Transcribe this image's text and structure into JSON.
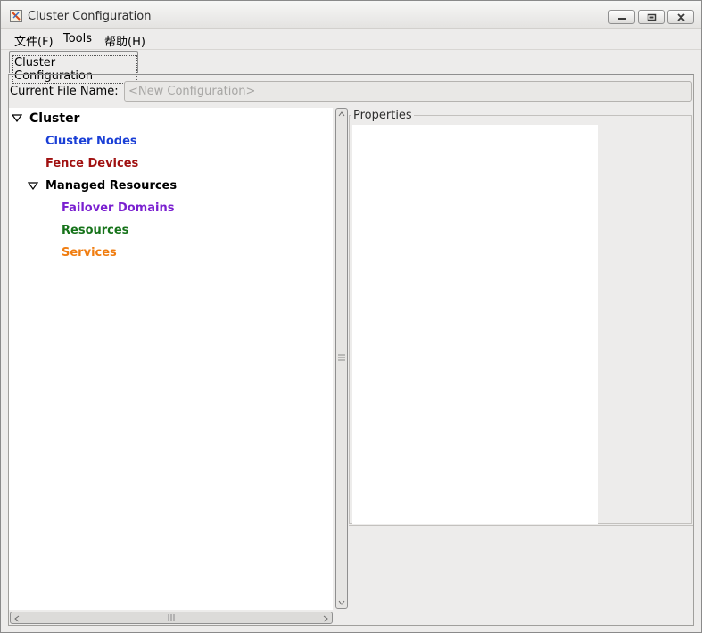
{
  "window": {
    "title": "Cluster Configuration"
  },
  "menu": {
    "items": [
      "文件(F)",
      "Tools",
      "帮助(H)"
    ]
  },
  "tabs": [
    "Cluster Configuration"
  ],
  "file": {
    "label": "Current File Name:",
    "placeholder": "<New Configuration>"
  },
  "tree": {
    "root": "Cluster",
    "items": [
      {
        "label": "Cluster Nodes",
        "color": "#1a3fd6"
      },
      {
        "label": "Fence Devices",
        "color": "#a01010"
      },
      {
        "label": "Managed Resources",
        "color": "#000000"
      },
      {
        "label": "Failover Domains",
        "color": "#7a1fd0"
      },
      {
        "label": "Resources",
        "color": "#16731a"
      },
      {
        "label": "Services",
        "color": "#f07d10"
      }
    ]
  },
  "properties": {
    "title": "Properties"
  },
  "icons": {
    "app": "app-config-icon",
    "minimize": "minimize-icon",
    "maximize": "maximize-icon",
    "close": "close-icon"
  }
}
